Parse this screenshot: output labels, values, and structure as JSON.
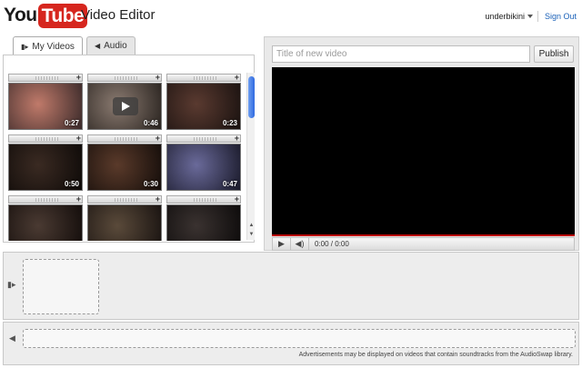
{
  "header": {
    "logo_you": "You",
    "logo_tube": "Tube",
    "title": "Video Editor",
    "username": "underbikini",
    "sign_out": "Sign Out"
  },
  "tabs": [
    {
      "label": "My Videos",
      "icon": "video-camera-icon",
      "active": true
    },
    {
      "label": "Audio",
      "icon": "speaker-icon",
      "active": false
    }
  ],
  "thumbnails": [
    {
      "duration": "0:27",
      "colors": [
        "#c07a6a",
        "#3a2a2a"
      ]
    },
    {
      "duration": "0:46",
      "colors": [
        "#8a7a70",
        "#2a2420"
      ]
    },
    {
      "duration": "0:23",
      "colors": [
        "#5a3a30",
        "#1a1210"
      ]
    },
    {
      "duration": "0:50",
      "colors": [
        "#3a2a22",
        "#0e0a08"
      ]
    },
    {
      "duration": "0:30",
      "colors": [
        "#5a3a2a",
        "#140d0a"
      ]
    },
    {
      "duration": "0:47",
      "colors": [
        "#6a6a9a",
        "#1a1a2a"
      ]
    },
    {
      "duration": "",
      "colors": [
        "#4a3a32",
        "#120c0a"
      ]
    },
    {
      "duration": "",
      "colors": [
        "#5a4a3a",
        "#181210"
      ]
    },
    {
      "duration": "",
      "colors": [
        "#3a3230",
        "#0c0a0a"
      ]
    }
  ],
  "player": {
    "title_placeholder": "Title of new video",
    "publish_label": "Publish",
    "time": "0:00 / 0:00"
  },
  "footer": {
    "ad_note": "Advertisements may be displayed on videos that contain soundtracks from the AudioSwap library."
  }
}
